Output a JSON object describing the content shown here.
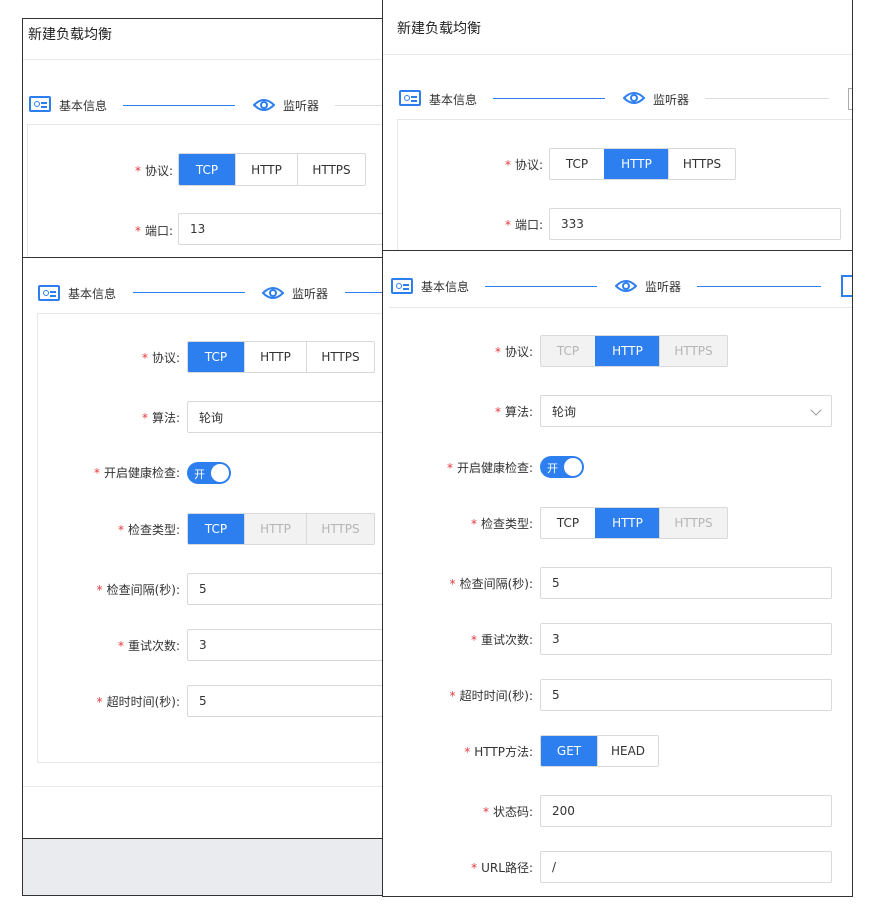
{
  "title": "新建负载均衡",
  "steps": {
    "basic": "基本信息",
    "listener": "监听器"
  },
  "panel_a": {
    "protocol": {
      "label": "协议",
      "options": [
        "TCP",
        "HTTP",
        "HTTPS"
      ],
      "selected": "TCP"
    },
    "port": {
      "label": "端口",
      "value": "13"
    }
  },
  "panel_b": {
    "protocol": {
      "label": "协议",
      "options": [
        "TCP",
        "HTTP",
        "HTTPS"
      ],
      "selected": "HTTP"
    },
    "port": {
      "label": "端口",
      "value": "333"
    }
  },
  "panel_c": {
    "protocol": {
      "label": "协议",
      "options": [
        "TCP",
        "HTTP",
        "HTTPS"
      ],
      "selected": "TCP"
    },
    "algorithm": {
      "label": "算法",
      "value": "轮询"
    },
    "health": {
      "label": "开启健康检查",
      "toggle_text": "开",
      "on": true
    },
    "check_type": {
      "label": "检查类型",
      "options": [
        "TCP",
        "HTTP",
        "HTTPS"
      ],
      "selected": "TCP"
    },
    "interval": {
      "label": "检查间隔(秒)",
      "value": "5"
    },
    "retry": {
      "label": "重试次数",
      "value": "3"
    },
    "timeout": {
      "label": "超时时间(秒)",
      "value": "5"
    }
  },
  "panel_d": {
    "protocol": {
      "label": "协议",
      "options": [
        "TCP",
        "HTTP",
        "HTTPS"
      ],
      "selected": "HTTP"
    },
    "algorithm": {
      "label": "算法",
      "value": "轮询"
    },
    "health": {
      "label": "开启健康检查",
      "toggle_text": "开",
      "on": true
    },
    "check_type": {
      "label": "检查类型",
      "options": [
        "TCP",
        "HTTP",
        "HTTPS"
      ],
      "selected": "HTTP"
    },
    "interval": {
      "label": "检查间隔(秒)",
      "value": "5"
    },
    "retry": {
      "label": "重试次数",
      "value": "3"
    },
    "timeout": {
      "label": "超时时间(秒)",
      "value": "5"
    },
    "http_method": {
      "label": "HTTP方法",
      "options": [
        "GET",
        "HEAD"
      ],
      "selected": "GET"
    },
    "status_code": {
      "label": "状态码",
      "value": "200"
    },
    "url_path": {
      "label": "URL路径",
      "value": "/"
    }
  },
  "colors": {
    "accent": "#2d7ff0",
    "required": "#e4393c"
  }
}
